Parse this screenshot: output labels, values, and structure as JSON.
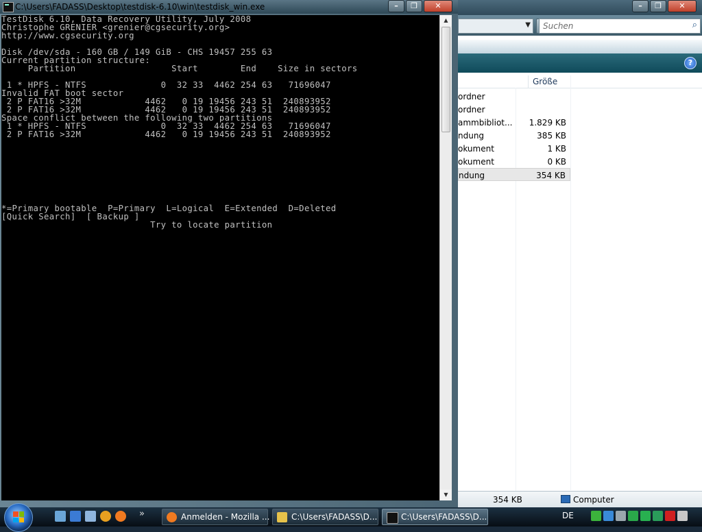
{
  "explorer": {
    "search_placeholder": "Suchen",
    "column_size": "Größe",
    "rows": [
      {
        "name": "ordner",
        "size": ""
      },
      {
        "name": "ordner",
        "size": ""
      },
      {
        "name": "ammbibliot...",
        "size": "1.829 KB"
      },
      {
        "name": "ndung",
        "size": "385 KB"
      },
      {
        "name": "okument",
        "size": "1 KB"
      },
      {
        "name": "okument",
        "size": "0 KB"
      },
      {
        "name": "ndung",
        "size": "354 KB",
        "selected": true
      }
    ],
    "status_size": "354 KB",
    "status_location": "Computer",
    "help_icon": "?"
  },
  "console": {
    "title": "C:\\Users\\FADASS\\Desktop\\testdisk-6.10\\win\\testdisk_win.exe",
    "lines": [
      "TestDisk 6.10, Data Recovery Utility, July 2008",
      "Christophe GRENIER <grenier@cgsecurity.org>",
      "http://www.cgsecurity.org",
      "",
      "Disk /dev/sda - 160 GB / 149 GiB - CHS 19457 255 63",
      "Current partition structure:",
      "     Partition                  Start        End    Size in sectors",
      "",
      " 1 * HPFS - NTFS              0  32 33  4462 254 63   71696047",
      "Invalid FAT boot sector",
      " 2 P FAT16 >32M            4462   0 19 19456 243 51  240893952",
      " 2 P FAT16 >32M            4462   0 19 19456 243 51  240893952",
      "Space conflict between the following two partitions",
      " 1 * HPFS - NTFS              0  32 33  4462 254 63   71696047",
      " 2 P FAT16 >32M            4462   0 19 19456 243 51  240893952",
      "",
      "",
      "",
      "",
      "",
      "",
      "",
      "",
      "*=Primary bootable  P=Primary  L=Logical  E=Extended  D=Deleted",
      "[Quick Search]  [ Backup ]",
      "                            Try to locate partition"
    ]
  },
  "taskbar": {
    "buttons": [
      {
        "label": "Anmelden - Mozilla ...",
        "icon": "firefox-icon"
      },
      {
        "label": "C:\\Users\\FADASS\\D...",
        "icon": "folder-icon"
      },
      {
        "label": "C:\\Users\\FADASS\\D...",
        "icon": "console-icon",
        "active": true
      }
    ],
    "more": "»",
    "language": "DE"
  },
  "colors": {
    "console_bg": "#000000",
    "console_text": "#c0c0c0",
    "close_button": "#c0402a"
  }
}
